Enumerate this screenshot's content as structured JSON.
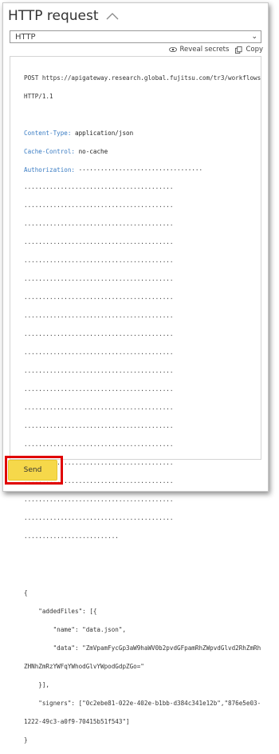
{
  "panel": {
    "title": "HTTP request"
  },
  "protocol_select": {
    "value": "HTTP"
  },
  "actions": {
    "reveal_label": "Reveal secrets",
    "copy_label": "Copy"
  },
  "request": {
    "line1": "POST https://apigateway.research.global.fujitsu.com/tr3/workflows",
    "line2": "HTTP/1.1",
    "headers": [
      {
        "name": "Content-Type:",
        "value": " application/json"
      },
      {
        "name": "Cache-Control:",
        "value": " no-cache"
      },
      {
        "name": "Authorization:",
        "value": " ··································"
      }
    ],
    "auth_lines": [
      "·········································",
      "·········································",
      "·········································",
      "·········································",
      "·········································",
      "·········································",
      "·········································",
      "·········································",
      "·········································",
      "·········································",
      "·········································",
      "·········································",
      "·········································",
      "·········································",
      "·········································",
      "·········································",
      "·········································",
      "·········································",
      "·········································",
      "··························"
    ],
    "body_lines": [
      "{",
      "    \"addedFiles\": [{",
      "        \"name\": \"data.json\",",
      "        \"data\": \"ZmVpamFycGp3aW9haWV0b2pvdGFpamRhZWpvdGlvd2RhZmRh",
      "ZHNhZmRzYWFqYWhodGlvYWpodGdpZGo=\"",
      "    }],",
      "    \"signers\": [\"0c2ebe81-022e-402e-b1bb-d384c341e12b\",\"876e5e03-",
      "1222-49c3-a0f9-70415b51f543\"]",
      "}"
    ]
  },
  "send_button": {
    "label": "Send"
  }
}
